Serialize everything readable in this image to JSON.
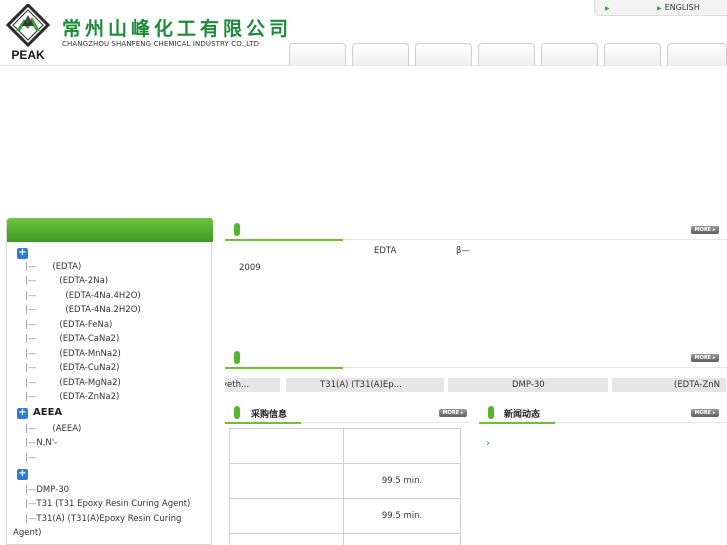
{
  "header": {
    "logo_text": "PEAK",
    "company_cn": "常州山峰化工有限公司",
    "company_en": "CHANGZHOU SHANFENG CHEMICAL INDUSTRY CO.,LTD",
    "lang_link": "ENGLISH",
    "nav_tabs": [
      "",
      "",
      "",
      "",
      "",
      "",
      ""
    ]
  },
  "sidebar": {
    "categories": [
      {
        "title": "",
        "items": [
          "(EDTA)",
          "(EDTA-2Na)",
          "(EDTA-4Na.4H2O)",
          "(EDTA-4Na.2H2O)",
          "(EDTA-FeNa)",
          "(EDTA-CaNa2)",
          "(EDTA-MnNa2)",
          "(EDTA-CuNa2)",
          "(EDTA-MgNa2)",
          "(EDTA-ZnNa2)"
        ]
      },
      {
        "title": "AEEA",
        "items": [
          "(AEEA)",
          "N,N'-",
          ""
        ]
      },
      {
        "title": "",
        "items": [
          "DMP-30",
          "T31      (T31 Epoxy Resin Curing Agent)",
          "T31(A)      (T31(A)Epoxy Resin Curing",
          "Agent)"
        ]
      }
    ]
  },
  "intro": {
    "more_label": "MORE",
    "line1_a": "EDTA",
    "line1_b": "β—",
    "line2": "2009"
  },
  "products": {
    "more_label": "MORE",
    "ticker": [
      "yeth...",
      "T31(A)      (T31(A)Ep...",
      "DMP-30",
      "(EDTA-ZnN"
    ]
  },
  "purchase": {
    "title": "采购信息",
    "more_label": "MORE",
    "rows": [
      [
        "",
        ""
      ],
      [
        "",
        "99.5 min."
      ],
      [
        "",
        "99.5 min."
      ],
      [
        "",
        ""
      ]
    ]
  },
  "news": {
    "title": "新闻动态",
    "more_label": "MORE",
    "items": [
      "›"
    ]
  },
  "colors": {
    "brand_green": "#1f8a3a",
    "accent_green": "#55b52c",
    "link_blue": "#2d7fd4"
  }
}
